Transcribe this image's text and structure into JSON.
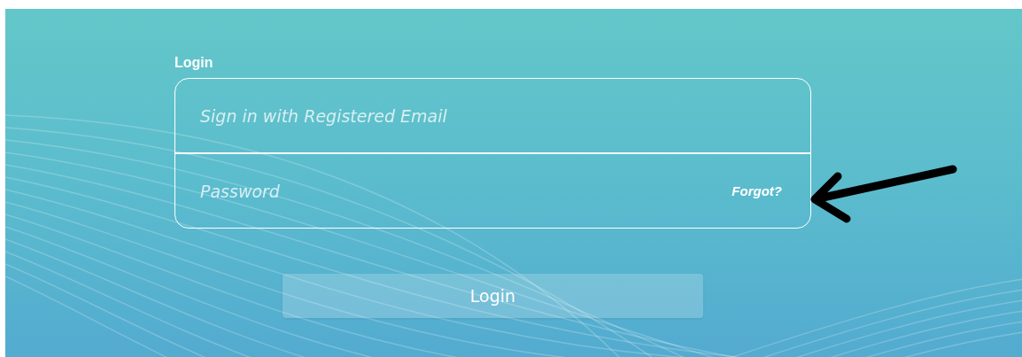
{
  "login_form": {
    "label": "Login",
    "email_field": {
      "placeholder": "Sign in with Registered Email"
    },
    "password_field": {
      "placeholder": "Password"
    },
    "forgot_link": "Forgot?",
    "submit_button": {
      "label": "Login"
    }
  }
}
